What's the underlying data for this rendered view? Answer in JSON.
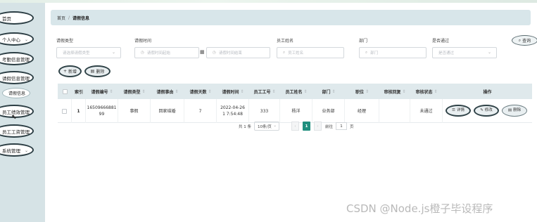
{
  "sidebar": {
    "items": [
      {
        "label": "首页"
      },
      {
        "label": "个人中心"
      },
      {
        "label": "考勤信息管理"
      },
      {
        "label": "请假信息管理"
      },
      {
        "label": "请假信息"
      },
      {
        "label": "员工绩效管理"
      },
      {
        "label": "员工工资管理"
      },
      {
        "label": "系统管理"
      }
    ]
  },
  "breadcrumb": {
    "home": "首页",
    "separator": "/",
    "current": "请假信息"
  },
  "filters": {
    "leave_type": {
      "label": "请假类型",
      "placeholder": "请选择请假类型"
    },
    "leave_time": {
      "label": "请假时间",
      "start_placeholder": "请假时间起始",
      "end_placeholder": "请假时间结束"
    },
    "employee_name": {
      "label": "员工姓名",
      "placeholder": "员工姓名"
    },
    "department": {
      "label": "部门",
      "placeholder": "部门"
    },
    "approved": {
      "label": "是否通过",
      "placeholder": "是否通过"
    }
  },
  "buttons": {
    "query": "查询",
    "add": "新增",
    "delete": "删除"
  },
  "table": {
    "headers": [
      "索引",
      "请假编号",
      "请假类型",
      "请假事由",
      "请假天数",
      "请假时间",
      "员工工号",
      "员工姓名",
      "部门",
      "职位",
      "审核回复",
      "审核状态",
      "操作"
    ],
    "rows": [
      {
        "index": "1",
        "leave_no": "16509666881 99",
        "leave_type": "事假",
        "reason": "回家结婚",
        "days": "7",
        "leave_time": "2022-04-26 1 7:54:48",
        "emp_no": "333",
        "emp_name": "杨洋",
        "department": "业务部",
        "position": "经理",
        "reply": "",
        "status": "未通过",
        "actions": {
          "detail": "详情",
          "edit": "修改",
          "delete": "删除"
        }
      }
    ]
  },
  "pagination": {
    "total": "共 1 条",
    "page_size": "10条/页",
    "prev": "‹",
    "current_page": "1",
    "next": "›",
    "goto_label": "前往",
    "goto_value": "1",
    "page_unit": "页"
  },
  "watermark": "CSDN @Node.js橙子毕设程序",
  "icons": {
    "search": "⌕",
    "calendar": "▦",
    "plus": "+",
    "trash": "🗑",
    "edit": "✎",
    "detail": "☰",
    "chevron_down": "⌄",
    "sort": "⇕"
  }
}
